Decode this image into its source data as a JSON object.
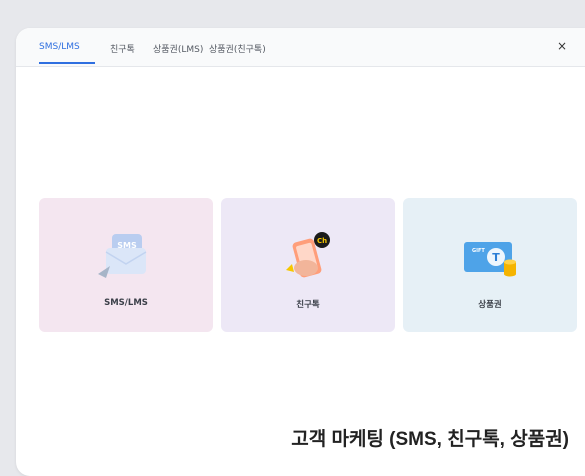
{
  "tabs": [
    {
      "label": "SMS/LMS",
      "active": true
    },
    {
      "label": "친구톡",
      "active": false
    },
    {
      "label": "상품권(LMS)",
      "active": false
    },
    {
      "label": "상품권(친구톡)",
      "active": false
    }
  ],
  "close_label": "×",
  "cards": [
    {
      "label": "SMS/LMS",
      "icon": "sms-envelope-icon",
      "bg": "#f4e6f0",
      "icon_text": "SMS"
    },
    {
      "label": "친구톡",
      "icon": "chat-phone-icon",
      "bg": "#ede8f6",
      "icon_text": "Ch"
    },
    {
      "label": "상품권",
      "icon": "gift-card-icon",
      "bg": "#e6f0f6",
      "icon_text": "GIFT"
    }
  ],
  "caption": "고객 마케팅 (SMS, 친구톡, 상품권)",
  "colors": {
    "accent": "#2f6fe0"
  }
}
